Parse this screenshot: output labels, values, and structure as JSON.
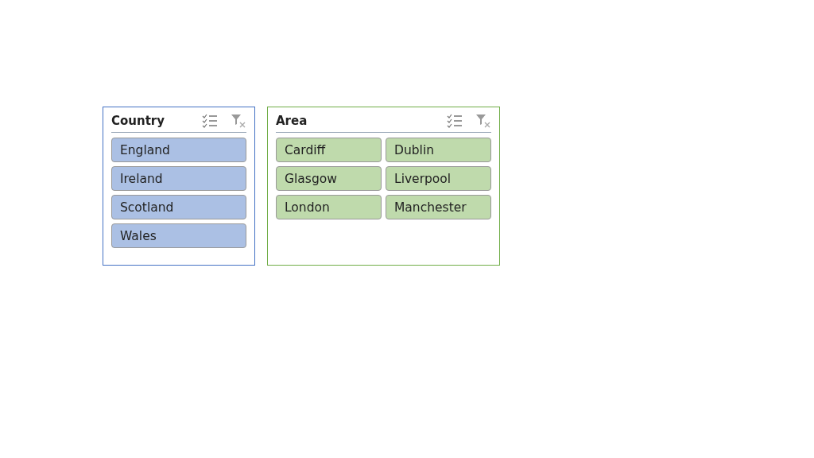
{
  "slicers": [
    {
      "title": "Country",
      "color": "#4472c4",
      "kind": "one-column",
      "items": [
        {
          "label": "England",
          "selected": true
        },
        {
          "label": "Ireland",
          "selected": true
        },
        {
          "label": "Scotland",
          "selected": true
        },
        {
          "label": "Wales",
          "selected": true
        }
      ]
    },
    {
      "title": "Area",
      "color": "#70ad47",
      "kind": "two-column",
      "items": [
        {
          "label": "Cardiff",
          "selected": true
        },
        {
          "label": "Dublin",
          "selected": true
        },
        {
          "label": "Glasgow",
          "selected": true
        },
        {
          "label": "Liverpool",
          "selected": true
        },
        {
          "label": "London",
          "selected": true
        },
        {
          "label": "Manchester",
          "selected": true
        }
      ]
    }
  ]
}
